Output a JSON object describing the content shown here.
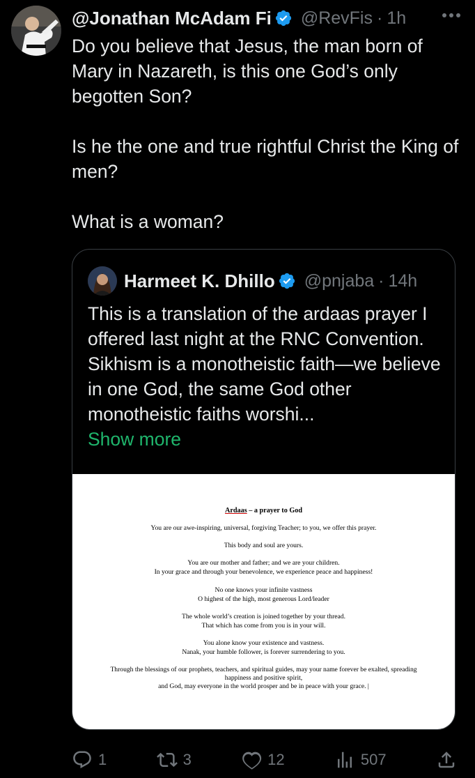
{
  "tweet": {
    "display_name": "@Jonathan McAdam Fi",
    "handle": "@RevFis",
    "separator": "·",
    "time": "1h",
    "paragraphs": [
      "Do you believe that Jesus, the man born of Mary in Nazareth, is this one God’s only begotten Son?",
      "Is he the one and true rightful Christ the King of men?",
      "What is a woman?"
    ]
  },
  "quote": {
    "display_name": "Harmeet K. Dhillo",
    "handle": "@pnjaba",
    "separator": "·",
    "time": "14h",
    "text": "This is a translation of the ardaas prayer I offered last night at the RNC Convention. Sikhism is a monotheistic faith—we believe in one God, the same God other monotheistic faiths worshi...",
    "show_more": "Show more",
    "document": {
      "title_underlined": "Ardaas",
      "title_rest": " – a prayer to God",
      "lines": [
        "You are our awe-inspiring, universal, forgiving Teacher; to you, we offer this prayer.",
        "This body and soul are yours.",
        "You are our mother and father; and we are your children.",
        "In your grace and through your benevolence, we experience peace and happiness!",
        "No one knows your infinite vastness",
        "O highest of the high, most generous Lord/leader",
        "The whole world’s creation is joined together by your thread.",
        "That which has come from you is in your will.",
        "You alone know your existence and vastness.",
        "Nanak, your humble follower, is forever surrendering to you.",
        "Through the blessings of our prophets, teachers, and spiritual guides, may your name forever be exalted, spreading",
        "happiness and positive spirit,",
        "and God, may everyone in the world prosper and be in peace with your grace. |"
      ]
    }
  },
  "actions": {
    "replies": "1",
    "reposts": "3",
    "likes": "12",
    "views": "507"
  },
  "colors": {
    "background": "#000000",
    "text": "#e7e9ea",
    "muted": "#71767b",
    "verified": "#1d9bf0",
    "show_more": "#1fb56c",
    "border": "#3a3f44"
  }
}
